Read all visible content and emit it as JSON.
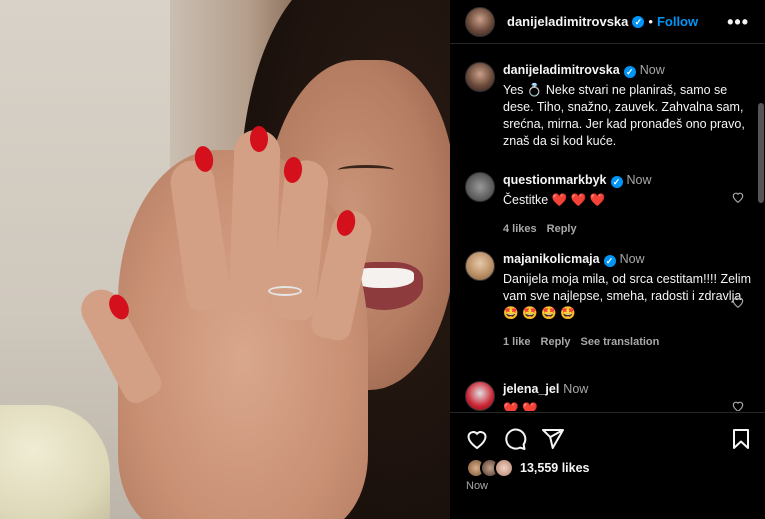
{
  "post": {
    "author": "danijeladimitrovska",
    "follow_label": "Follow",
    "more_label": "•••",
    "caption_time": "Now",
    "caption": "Yes 💍 Neke stvari ne planiraš, samo se dese. Tiho, snažno, zauvek. Zahvalna sam, srećna, mirna. Jer kad pronađeš ono pravo, znaš da si kod kuće."
  },
  "comments": [
    {
      "user": "questionmarkbyk",
      "time": "Now",
      "text": "Čestitke ❤️ ❤️ ❤️",
      "likes": "4 likes",
      "reply": "Reply"
    },
    {
      "user": "majanikolicmaja",
      "time": "Now",
      "text": "Danijela moja mila, od srca cestitam!!!! Zelim vam sve najlepse, smeha, radosti i zdravlja🤩 🤩 🤩 🤩",
      "likes": "1 like",
      "reply": "Reply",
      "translate": "See translation"
    },
    {
      "user": "jelena_jel",
      "time": "Now",
      "text": "❤️ ❤️"
    }
  ],
  "footer": {
    "likes": "13,559 likes",
    "posted": "Now"
  },
  "colors": {
    "accent": "#0095f6",
    "background": "#000000",
    "muted": "#a8a8a8",
    "heart_red": "#ff3040"
  }
}
